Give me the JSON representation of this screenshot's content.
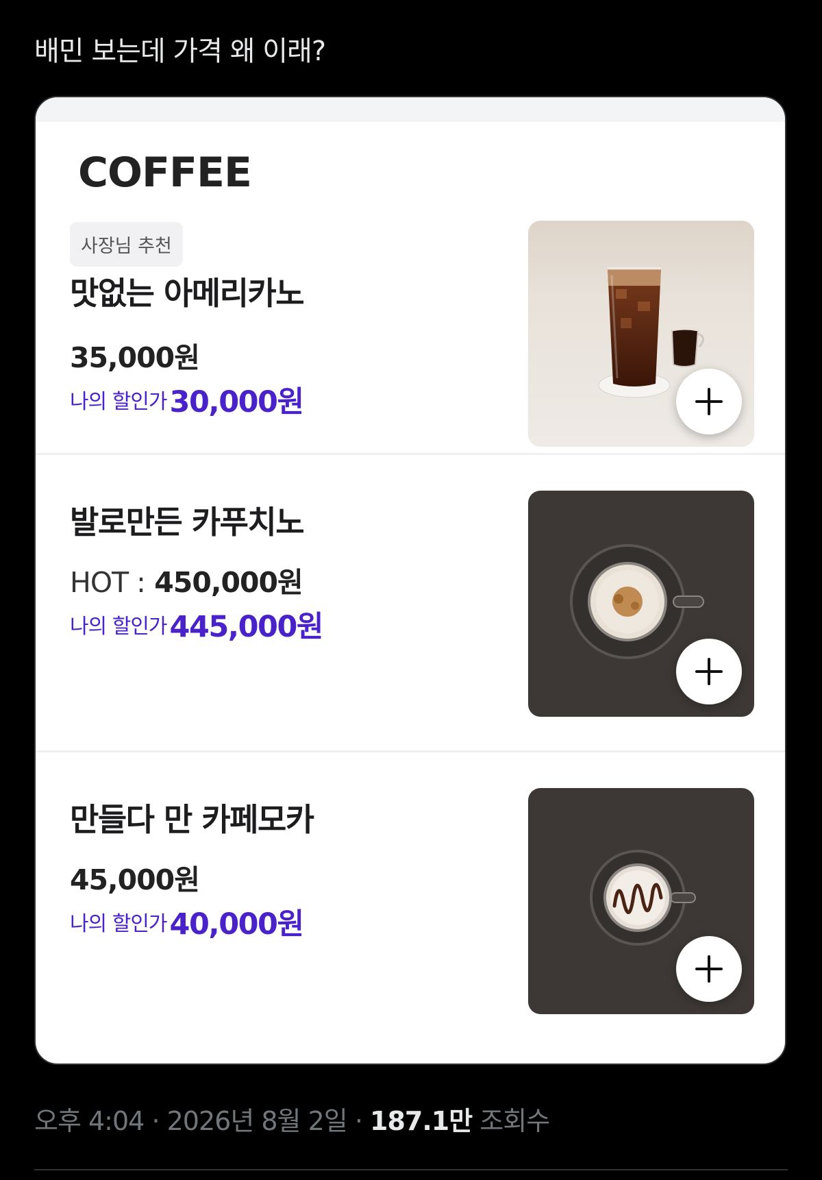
{
  "tweet": {
    "text": "배민 보는데 가격 왜 이래?"
  },
  "menu": {
    "section_title": "COFFEE",
    "items": [
      {
        "badge": "사장님 추천",
        "name": "맛없는 아메리카노",
        "price_option": "",
        "price": "35,000원",
        "discount_label": "나의 할인가",
        "discount_price": "30,000원",
        "photo": "iced-americano-image"
      },
      {
        "name": "발로만든 카푸치노",
        "price_option": "HOT :",
        "price": "450,000원",
        "discount_label": "나의 할인가",
        "discount_price": "445,000원",
        "photo": "cappuccino-image"
      },
      {
        "name": "만들다 만 카페모카",
        "price_option": "",
        "price": "45,000원",
        "discount_label": "나의 할인가",
        "discount_price": "40,000원",
        "photo": "cafe-mocha-image"
      }
    ]
  },
  "meta": {
    "time": "오후 4:04",
    "sep1": "·",
    "date": "2026년 8월 2일",
    "sep2": "·",
    "views_count": "187.1만",
    "views_label": "조회수"
  },
  "colors": {
    "discount": "#4a22c9",
    "background": "#000000",
    "card": "#ffffff"
  }
}
